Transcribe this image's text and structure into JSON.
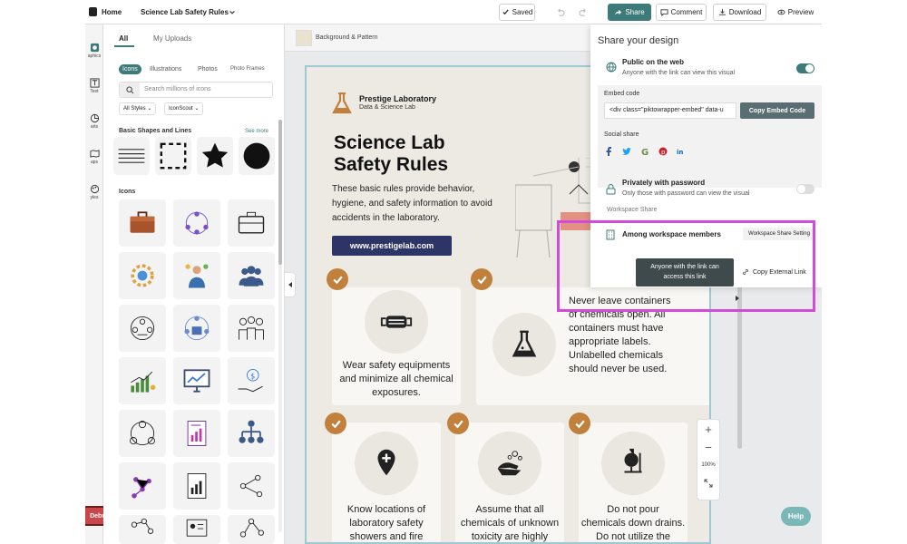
{
  "topbar": {
    "home_label": "Home",
    "doc_title": "Science Lab Safety Rules",
    "saved_label": "Saved",
    "share_label": "Share",
    "comment_label": "Comment",
    "download_label": "Download",
    "preview_label": "Preview"
  },
  "rail": {
    "items": [
      {
        "label": "aphics",
        "icon": "graphics-icon"
      },
      {
        "label": "Text",
        "icon": "text-icon"
      },
      {
        "label": "arts",
        "icon": "charts-icon"
      },
      {
        "label": "aps",
        "icon": "maps-icon"
      },
      {
        "label": "yles",
        "icon": "styles-icon"
      }
    ],
    "debug_label": "Debug"
  },
  "panel": {
    "tabs": [
      "All",
      "My Uploads"
    ],
    "chips": [
      "Icons",
      "Illustrations",
      "Photos",
      "Photo Frames"
    ],
    "search_placeholder": "Search millions of icons",
    "filter_styles": "All Styles",
    "filter_source": "IconScout",
    "basic_shapes_title": "Basic Shapes and Lines",
    "see_more": "See more",
    "icons_title": "Icons"
  },
  "canvas": {
    "bg_pattern_label": "Background & Pattern",
    "brand_name": "Prestige Laboratory",
    "brand_sub": "Data & Science Lab",
    "title_line1": "Science Lab",
    "title_line2": "Safety Rules",
    "intro": [
      "These basic rules provide behavior,",
      "hygiene, and safety information to avoid",
      "accidents in the laboratory."
    ],
    "url_button": "www.prestigelab.com",
    "cards": [
      {
        "lines": [
          "Wear safety equipments",
          "and minimize all chemical",
          "exposures."
        ],
        "icon": "mask-icon"
      },
      {
        "lines": [
          "Never leave containers",
          "of chemicals open. All",
          "containers must have",
          "appropriate labels.",
          "Unlabelled chemicals",
          "should never be used."
        ],
        "icon": "flask-icon"
      },
      {
        "lines": [
          "Know locations of",
          "laboratory safety",
          "showers and fire"
        ],
        "icon": "location-icon"
      },
      {
        "lines": [
          "Assume that all",
          "chemicals of unknown",
          "toxicity are highly"
        ],
        "icon": "handwash-icon"
      },
      {
        "lines": [
          "Do not pour",
          "chemicals down drains.",
          "Do not utilize the"
        ],
        "icon": "burner-icon"
      }
    ]
  },
  "zoom": {
    "plus": "+",
    "minus": "−",
    "level": "100%"
  },
  "share": {
    "heading": "Share your design",
    "public_title": "Public on the web",
    "public_sub": "Anyone with the link can view this visual",
    "embed_label": "Embed code",
    "embed_value": "<div class=\"piktowrapper-embed\" data-u",
    "copy_embed": "Copy Embed Code",
    "social_label": "Social share",
    "private_title": "Privately with password",
    "private_sub": "Only those with password can view the visual",
    "workspace_share": "Workspace Share",
    "members_title": "Among workspace members",
    "workspace_settings": "Workspace Share Setting",
    "tooltip_line1": "Anyone with the link can",
    "tooltip_line2": "access this link",
    "copy_external": "Copy External Link"
  },
  "help_label": "Help",
  "colors": {
    "accent": "#3d7a7a",
    "highlight": "#d24ad8",
    "check": "#c2803d",
    "url_button": "#2c3566",
    "toggle_on": "#3d7a7a"
  }
}
